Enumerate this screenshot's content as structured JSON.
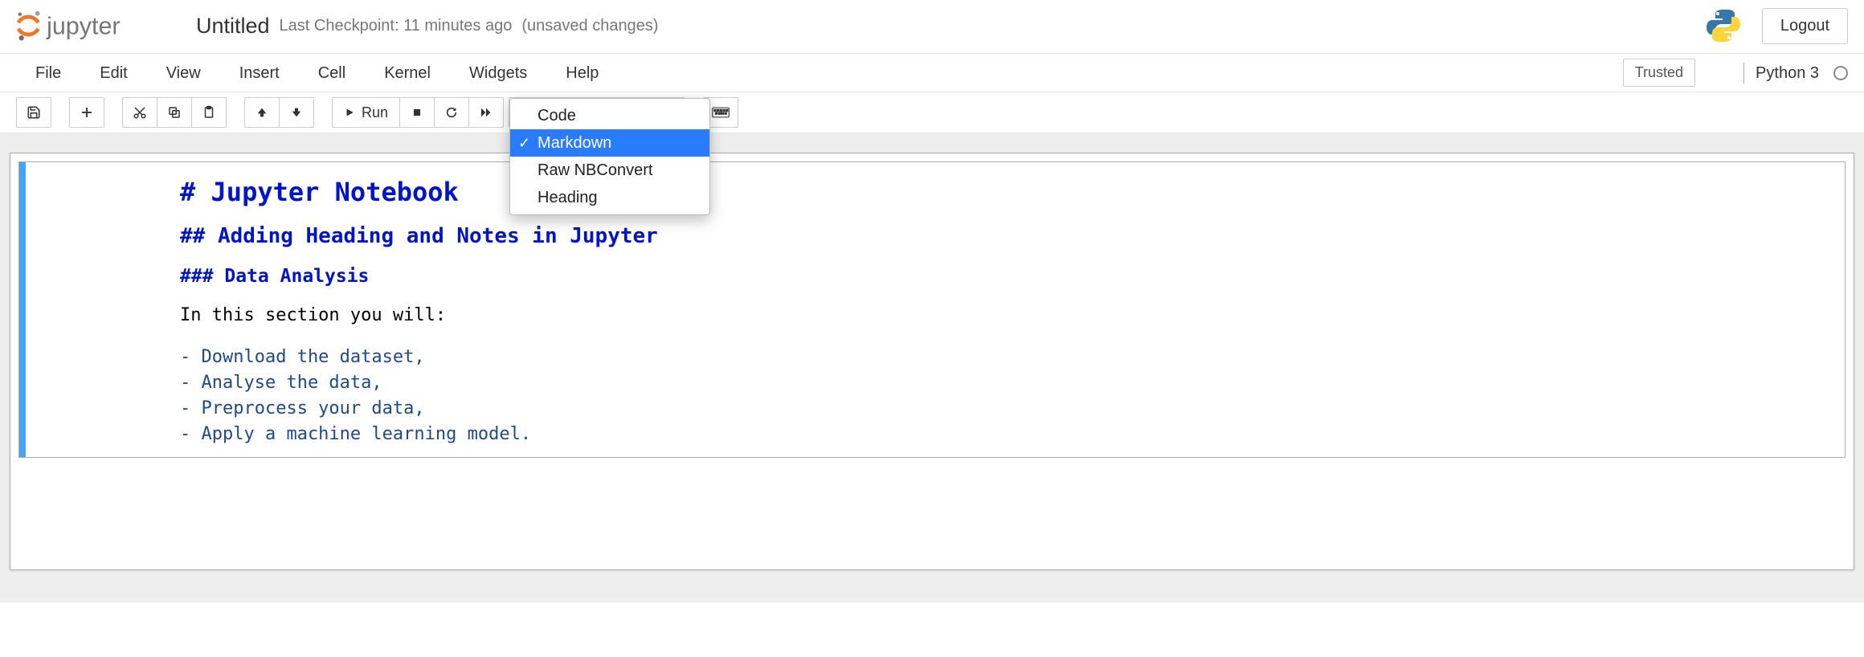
{
  "header": {
    "title": "Untitled",
    "checkpoint": "Last Checkpoint: 11 minutes ago",
    "unsaved": "(unsaved changes)",
    "logout": "Logout"
  },
  "menubar": {
    "items": [
      "File",
      "Edit",
      "View",
      "Insert",
      "Cell",
      "Kernel",
      "Widgets",
      "Help"
    ],
    "trusted": "Trusted",
    "kernel": "Python 3"
  },
  "toolbar": {
    "run_label": "Run",
    "celltype_options": [
      "Code",
      "Markdown",
      "Raw NBConvert",
      "Heading"
    ],
    "celltype_selected": "Markdown"
  },
  "cell": {
    "h1": "# Jupyter Notebook",
    "h2": "## Adding Heading and Notes in Jupyter",
    "h3": "### Data Analysis",
    "body": "In this section you will:",
    "list": [
      "- Download the dataset,",
      "- Analyse the data,",
      "- Preprocess your data,",
      "- Apply a machine learning model."
    ]
  }
}
